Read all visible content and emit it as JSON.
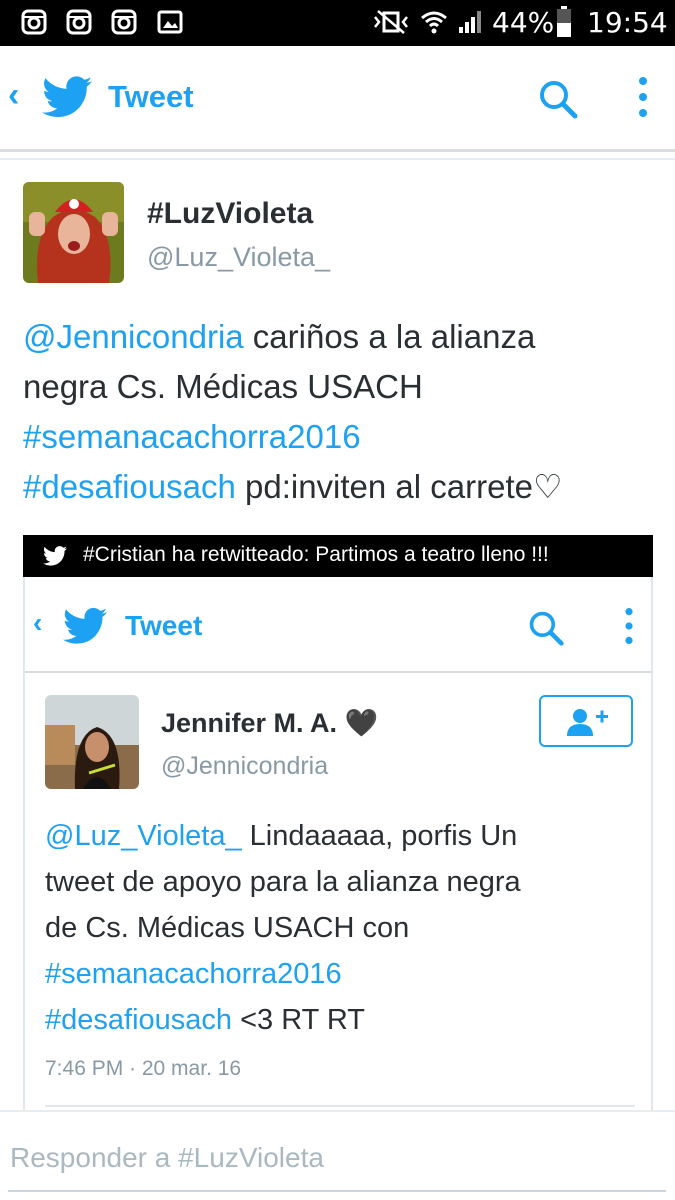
{
  "status_bar": {
    "battery": "44%",
    "time": "19:54",
    "left_icons": [
      "instagram-icon",
      "instagram-icon",
      "instagram-icon",
      "image-icon"
    ],
    "right_icons": [
      "vibrate-icon",
      "wifi-icon",
      "signal-icon",
      "battery-icon"
    ]
  },
  "app_bar": {
    "title": "Tweet",
    "icons": [
      "back-icon",
      "twitter-bird-icon",
      "search-icon",
      "more-vert-icon"
    ]
  },
  "tweet": {
    "display_name": "#LuzVioleta",
    "handle": "@Luz_Violeta_",
    "text": {
      "mention": "@Jennicondria",
      "part1": " cariños a la alianza",
      "part2": "negra Cs. Médicas USACH",
      "hashtag1": "#semanacachorra2016",
      "hashtag2": "#desafiousach",
      "part3": " pd:inviten al carrete♡"
    }
  },
  "retweet_banner": {
    "text": "#Cristian ha retwitteado: Partimos a teatro lleno !!!"
  },
  "embedded": {
    "app_bar_title": "Tweet",
    "display_name": "Jennifer M. A.",
    "heart": "🖤",
    "handle": "@Jennicondria",
    "text": {
      "mention": "@Luz_Violeta_",
      "part1": " Lindaaaaa, porfis Un",
      "part2": "tweet de apoyo para la alianza negra",
      "part3": "de Cs. Médicas USACH con",
      "hashtag1": "#semanacachorra2016",
      "hashtag2": "#desafiousach",
      "part4": " <3 RT RT"
    },
    "timestamp": "7:46 PM · 20 mar. 16"
  },
  "reply": {
    "placeholder": "Responder a #LuzVioleta"
  },
  "colors": {
    "accent": "#1da1f2",
    "text": "#292f33",
    "muted": "#8899a6"
  }
}
